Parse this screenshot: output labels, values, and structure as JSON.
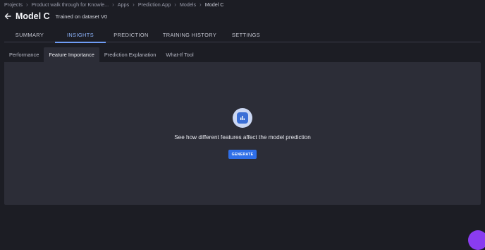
{
  "breadcrumb": {
    "items": [
      "Projects",
      "Product walk through for Knowle...",
      "Apps",
      "Prediction App",
      "Models",
      "Model C"
    ]
  },
  "header": {
    "title": "Model C",
    "subtitle": "Trained on dataset V0"
  },
  "tabs": [
    {
      "label": "SUMMARY",
      "active": false
    },
    {
      "label": "INSIGHTS",
      "active": true
    },
    {
      "label": "PREDICTION",
      "active": false
    },
    {
      "label": "TRAINING HISTORY",
      "active": false
    },
    {
      "label": "SETTINGS",
      "active": false
    }
  ],
  "subtabs": [
    {
      "label": "Performance",
      "active": false
    },
    {
      "label": "Feature Importance",
      "active": true
    },
    {
      "label": "Prediction Explanation",
      "active": false
    },
    {
      "label": "What-If Tool",
      "active": false
    }
  ],
  "empty_state": {
    "icon": "bar-chart-icon",
    "message": "See how different features affect the model prediction",
    "button_label": "GENERATE"
  },
  "colors": {
    "background": "#1c1d24",
    "panel": "#2c2d37",
    "accent": "#2f6fe8",
    "active_tab": "#8fb6ff",
    "fab": "#8a3cf0"
  }
}
